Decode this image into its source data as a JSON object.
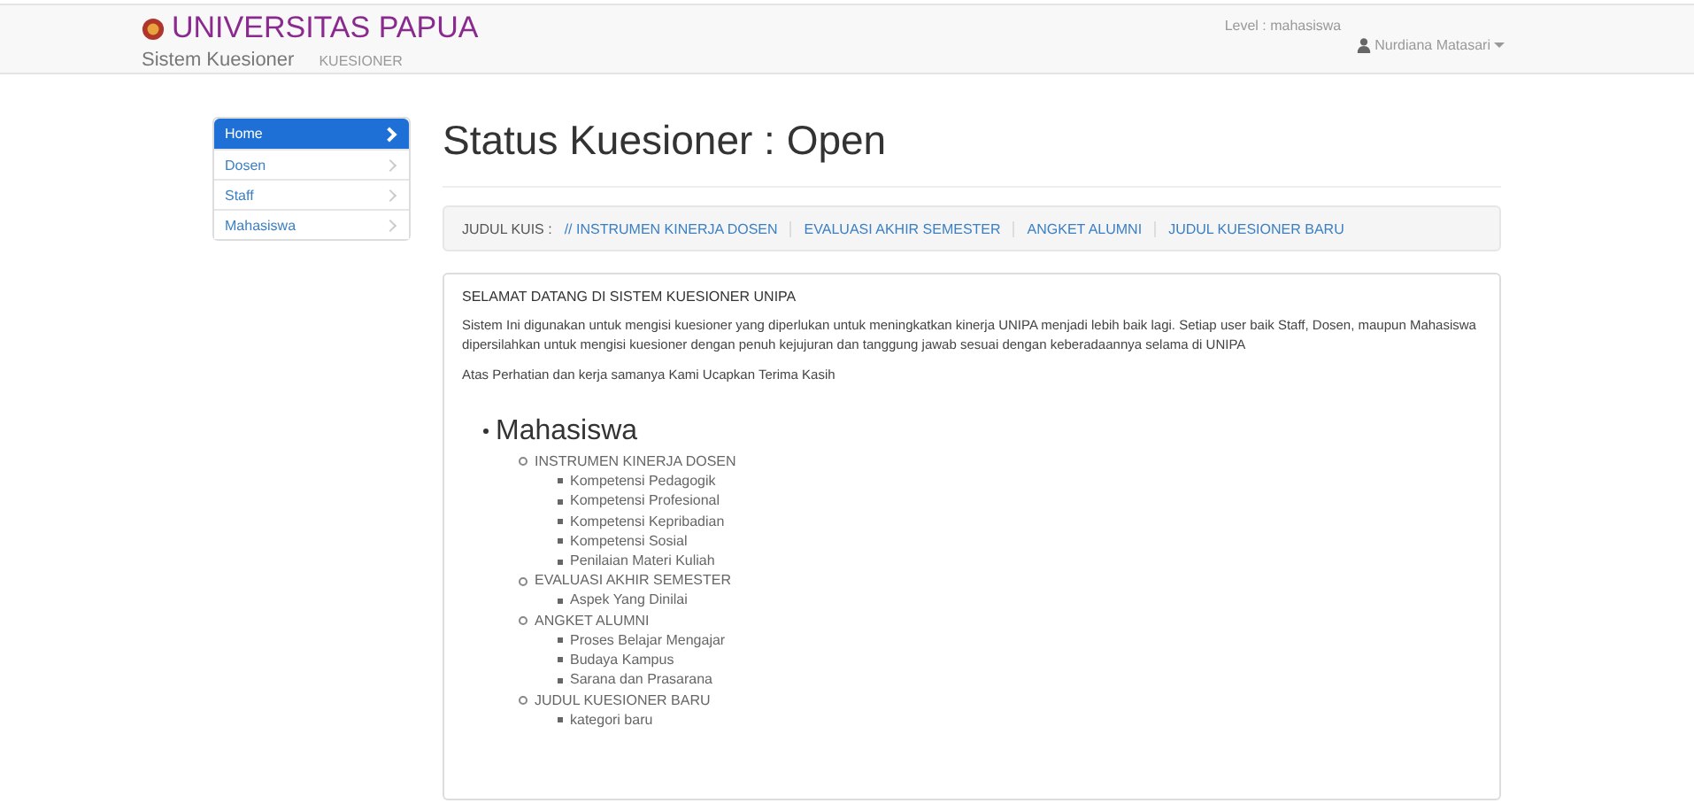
{
  "header": {
    "brand": "UNIVERSITAS PAPUA",
    "subtitle": "Sistem Kuesioner",
    "nav_link": "KUESIONER",
    "level": "Level : mahasiswa",
    "user": "Nurdiana Matasari"
  },
  "sidebar": {
    "items": [
      {
        "label": "Home",
        "selected": true
      },
      {
        "label": "Dosen",
        "selected": false
      },
      {
        "label": "Staff",
        "selected": false
      },
      {
        "label": "Mahasiswa",
        "selected": false
      }
    ]
  },
  "page_title": "Status Kuesioner : Open",
  "breadcrumb": {
    "label": "JUDUL KUIS :",
    "links": [
      "// INSTRUMEN KINERJA DOSEN",
      "EVALUASI AKHIR SEMESTER",
      "ANGKET ALUMNI",
      "JUDUL KUESIONER BARU"
    ]
  },
  "panel": {
    "heading": "SELAMAT DATANG DI SISTEM KUESIONER UNIPA",
    "paragraphs": [
      "Sistem Ini digunakan untuk mengisi kuesioner yang diperlukan untuk meningkatkan kinerja UNIPA menjadi lebih baik lagi. Setiap user baik Staff, Dosen, maupun Mahasiswa dipersilahkan untuk mengisi kuesioner dengan penuh kejujuran dan tanggung jawab sesuai dengan keberadaannya selama di UNIPA",
      "Atas Perhatian dan kerja samanya Kami Ucapkan Terima Kasih"
    ],
    "tree": [
      {
        "label": "Mahasiswa",
        "children": [
          {
            "label": "INSTRUMEN KINERJA DOSEN",
            "children": [
              {
                "label": "Kompetensi Pedagogik"
              },
              {
                "label": "Kompetensi Profesional"
              },
              {
                "label": "Kompetensi Kepribadian"
              },
              {
                "label": "Kompetensi Sosial"
              },
              {
                "label": "Penilaian Materi Kuliah"
              }
            ]
          },
          {
            "label": "EVALUASI AKHIR SEMESTER",
            "children": [
              {
                "label": "Aspek Yang Dinilai"
              }
            ]
          },
          {
            "label": "ANGKET ALUMNI",
            "children": [
              {
                "label": "Proses Belajar Mengajar"
              },
              {
                "label": "Budaya Kampus"
              },
              {
                "label": "Sarana dan Prasarana"
              }
            ]
          },
          {
            "label": "JUDUL KUESIONER BARU",
            "children": [
              {
                "label": "kategori baru"
              }
            ]
          }
        ]
      }
    ]
  }
}
